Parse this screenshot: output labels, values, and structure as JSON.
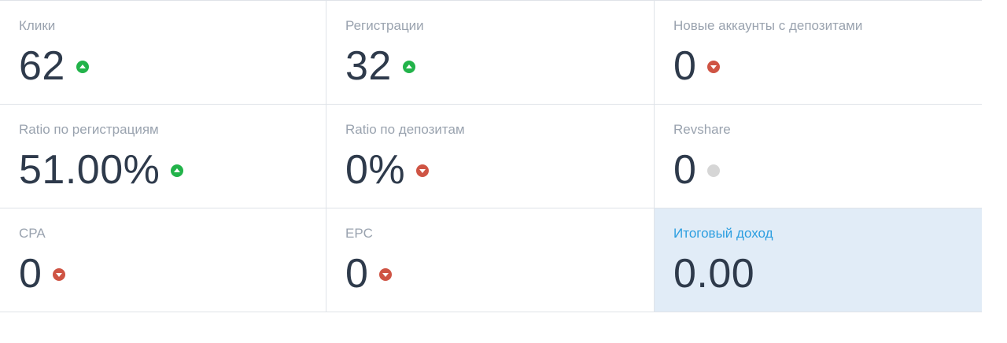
{
  "colors": {
    "up": "#22b34a",
    "down": "#cf5444",
    "neutral": "#d6d6d6",
    "highlight_bg": "#e1ecf7",
    "highlight_label": "#2c9ee0"
  },
  "stats": [
    {
      "label": "Клики",
      "value": "62",
      "trend": "up",
      "trend_icon": "arrow-up-circle-icon"
    },
    {
      "label": "Регистрации",
      "value": "32",
      "trend": "up",
      "trend_icon": "arrow-up-circle-icon"
    },
    {
      "label": "Новые аккаунты с депозитами",
      "value": "0",
      "trend": "down",
      "trend_icon": "arrow-down-circle-icon"
    },
    {
      "label": "Ratio по регистрациям",
      "value": "51.00%",
      "trend": "up",
      "trend_icon": "arrow-up-circle-icon"
    },
    {
      "label": "Ratio по депозитам",
      "value": "0%",
      "trend": "down",
      "trend_icon": "arrow-down-circle-icon"
    },
    {
      "label": "Revshare",
      "value": "0",
      "trend": "neutral",
      "trend_icon": "neutral-dot-icon"
    },
    {
      "label": "CPA",
      "value": "0",
      "trend": "down",
      "trend_icon": "arrow-down-circle-icon"
    },
    {
      "label": "EPC",
      "value": "0",
      "trend": "down",
      "trend_icon": "arrow-down-circle-icon"
    },
    {
      "label": "Итоговый доход",
      "value": "0.00"
    }
  ]
}
